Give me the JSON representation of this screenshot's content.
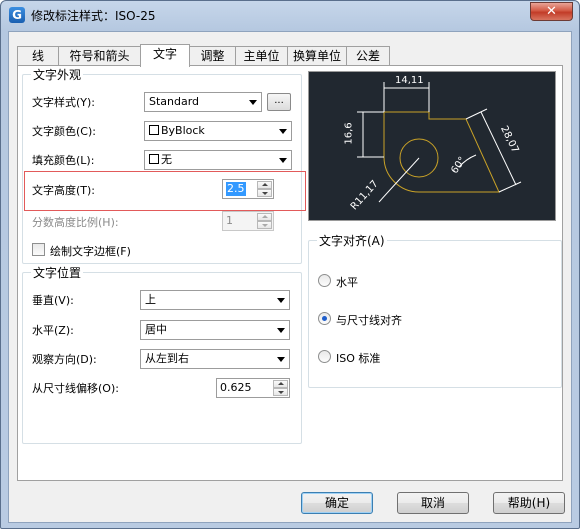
{
  "window": {
    "title": "修改标注样式：ISO-25",
    "app_icon": "G"
  },
  "tabs": [
    {
      "label": "线"
    },
    {
      "label": "符号和箭头"
    },
    {
      "label": "文字"
    },
    {
      "label": "调整"
    },
    {
      "label": "主单位"
    },
    {
      "label": "换算单位"
    },
    {
      "label": "公差"
    }
  ],
  "text_appearance": {
    "title": "文字外观",
    "style_label": "文字样式(Y):",
    "style_value": "Standard",
    "style_browse": "...",
    "color_label": "文字颜色(C):",
    "color_value": "ByBlock",
    "fill_label": "填充颜色(L):",
    "fill_value": "无",
    "height_label": "文字高度(T):",
    "height_value": "2.5",
    "fraction_label": "分数高度比例(H):",
    "fraction_value": "1",
    "frame_label": "绘制文字边框(F)"
  },
  "text_position": {
    "title": "文字位置",
    "vertical_label": "垂直(V):",
    "vertical_value": "上",
    "horizontal_label": "水平(Z):",
    "horizontal_value": "居中",
    "view_label": "观察方向(D):",
    "view_value": "从左到右",
    "offset_label": "从尺寸线偏移(O):",
    "offset_value": "0.625"
  },
  "text_alignment": {
    "title": "文字对齐(A)",
    "options": [
      {
        "label": "水平",
        "checked": false
      },
      {
        "label": "与尺寸线对齐",
        "checked": true
      },
      {
        "label": "ISO 标准",
        "checked": false
      }
    ]
  },
  "preview": {
    "dim_top": "14,11",
    "dim_left": "16,6",
    "dim_right": "28,07",
    "dim_angle": "60°",
    "dim_radius": "R11,17",
    "colors": {
      "background": "#212830",
      "dims": "#ffffff",
      "geometry": "#c9a227"
    }
  },
  "buttons": {
    "ok": "确定",
    "cancel": "取消",
    "help": "帮助(H)"
  },
  "colors": {
    "highlight_box": "#e25a5a",
    "selection": "#3399ff"
  }
}
